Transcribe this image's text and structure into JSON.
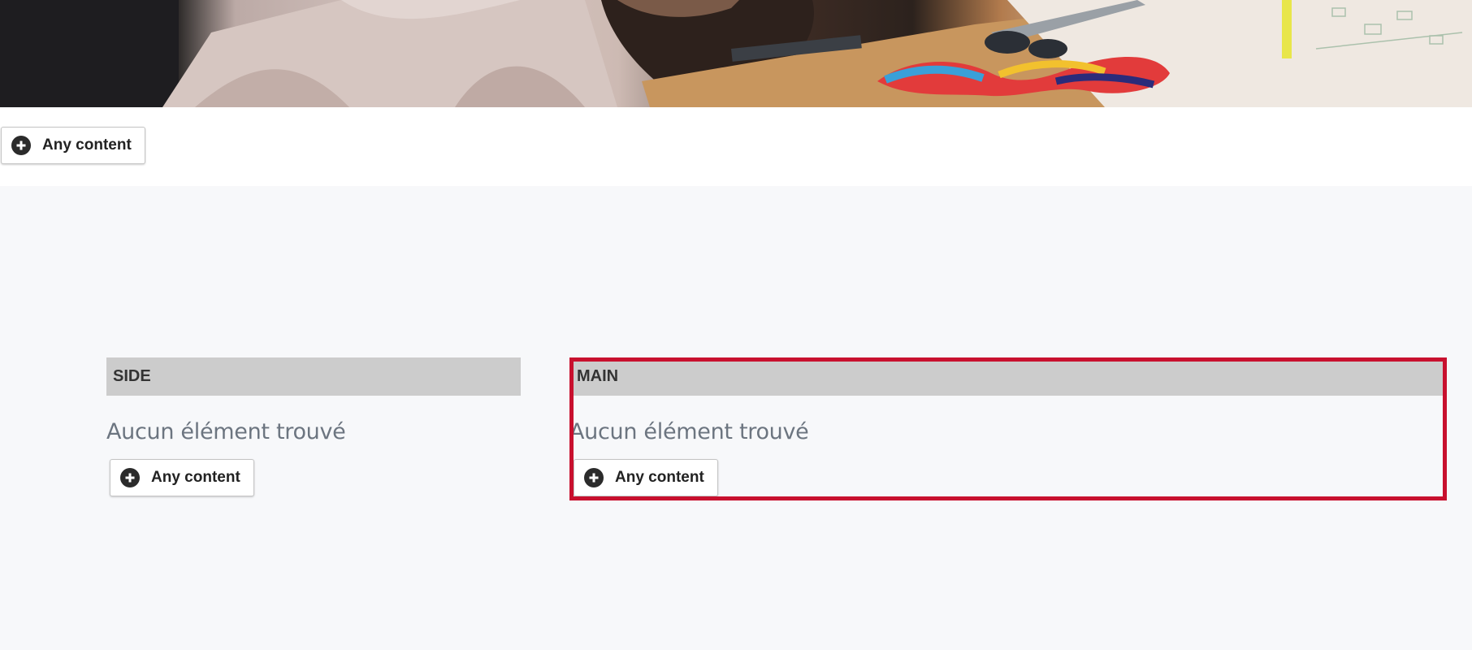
{
  "header": {
    "add_button_label": "Any content"
  },
  "regions": [
    {
      "title": "SIDE",
      "empty_message": "Aucun élément trouvé",
      "add_button_label": "Any content"
    },
    {
      "title": "MAIN",
      "empty_message": "Aucun élément trouvé",
      "add_button_label": "Any content",
      "highlighted": true
    }
  ],
  "colors": {
    "highlight_border": "#c8102e",
    "region_header_bg": "#cccccc",
    "band_bg": "#f7f8fa",
    "empty_text": "#6c7580"
  },
  "icons": {
    "add": "plus-circle-icon"
  }
}
